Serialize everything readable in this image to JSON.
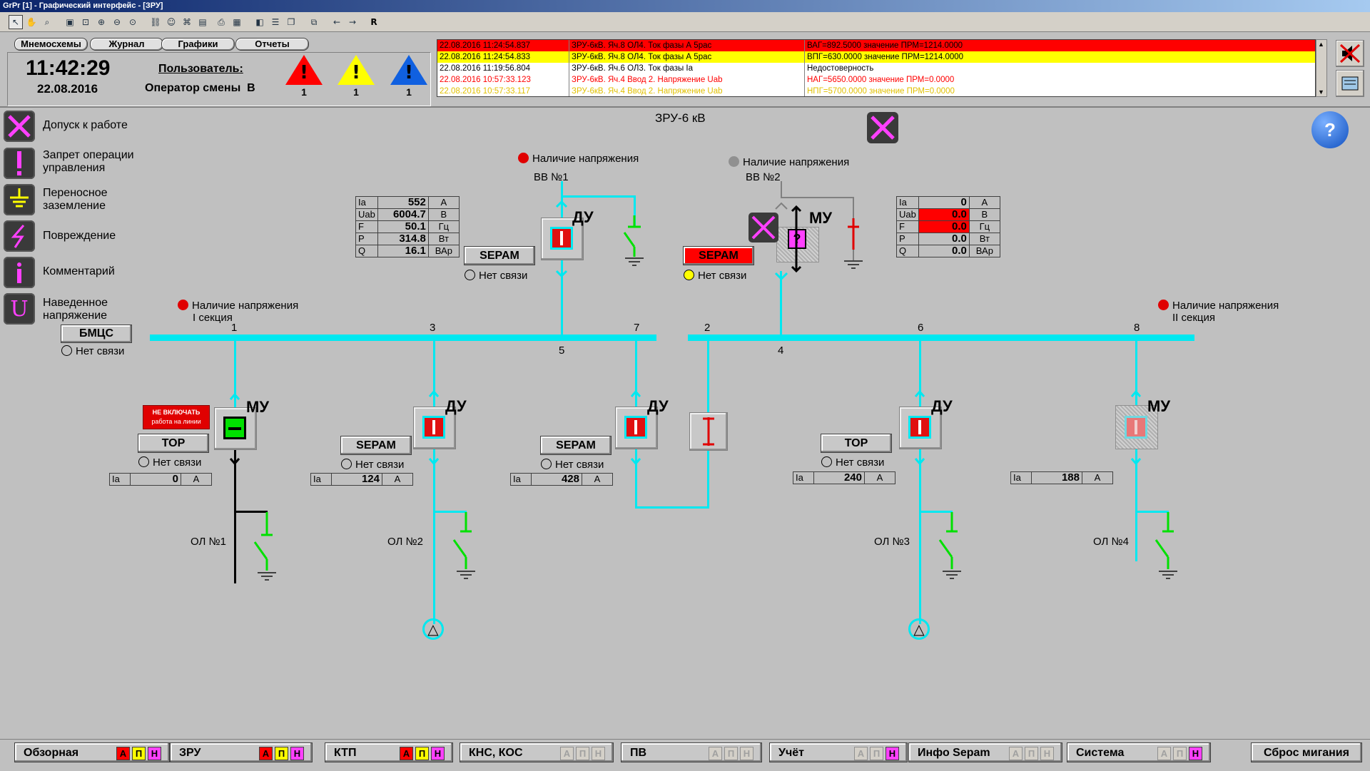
{
  "window": {
    "title": "GrPr [1] - Графический интерфейс - [ЗРУ]"
  },
  "toolbar": {
    "r_label": "R"
  },
  "header": {
    "tabs": [
      {
        "label": "Мнемосхемы"
      },
      {
        "label": "Журнал"
      },
      {
        "label": "Графики"
      },
      {
        "label": "Отчеты"
      }
    ],
    "clock": "11:42:29",
    "date": "22.08.2016",
    "user_label": "Пользователь:",
    "user_value": "Оператор смены  В",
    "alarm_counts": {
      "red": "1",
      "yellow": "1",
      "blue": "1"
    }
  },
  "events": [
    {
      "time": "22.08.2016 11:24:54.837",
      "source": "ЗРУ-6кВ. Яч.8 ОЛ4. Ток фазы А 5рас",
      "value": "ВАГ=892.5000  значение ПРМ=1214.0000",
      "bg": "#ff0000",
      "fg": "#000000"
    },
    {
      "time": "22.08.2016 11:24:54.833",
      "source": "ЗРУ-6кВ. Яч.8 ОЛ4. Ток фазы А 5рас",
      "value": "ВПГ=630.0000  значение ПРМ=1214.0000",
      "bg": "#ffff00",
      "fg": "#000000"
    },
    {
      "time": "22.08.2016 11:19:56.804",
      "source": "ЗРУ-6кВ. Яч.6 ОЛ3. Ток фазы Ia",
      "value": "Недостоверность",
      "bg": "#ffffff",
      "fg": "#000000"
    },
    {
      "time": "22.08.2016 10:57:33.123",
      "source": "ЗРУ-6кВ. Яч.4 Ввод 2. Напряжение Uab",
      "value": "НАГ=5650.0000  значение ПРМ=0.0000",
      "bg": "#ffffff",
      "fg": "#ff0000"
    },
    {
      "time": "22.08.2016 10:57:33.117",
      "source": "ЗРУ-6кВ. Яч.4 Ввод 2. Напряжение Uab",
      "value": "НПГ=5700.0000  значение ПРМ=0.0000",
      "bg": "#ffffff",
      "fg": "#e0c000"
    }
  ],
  "legend": [
    {
      "label": "Допуск к работе",
      "icon": "cross-tools-icon"
    },
    {
      "label": "Запрет операции управления",
      "icon": "exclamation-icon"
    },
    {
      "label": "Переносное заземление",
      "icon": "ground-icon"
    },
    {
      "label": "Повреждение",
      "icon": "lightning-icon"
    },
    {
      "label": "Комментарий",
      "icon": "info-icon"
    },
    {
      "label": "Наведенное напряжение",
      "icon": "induced-u-icon"
    }
  ],
  "legend_lines": [
    [
      "Допуск к работе"
    ],
    [
      "Запрет операции",
      "управления"
    ],
    [
      "Переносное",
      "заземление"
    ],
    [
      "Повреждение"
    ],
    [
      "Комментарий"
    ],
    [
      "Наведенное",
      "напряжение"
    ]
  ],
  "scheme": {
    "title": "ЗРУ-6 кВ",
    "voltage_label": "Наличие напряжения",
    "section1_label": "I секция",
    "section2_label": "II секция",
    "no_link": "Нет связи",
    "bmcs_label": "БМЦС",
    "input1_label": "ВВ №1",
    "input2_label": "ВВ №2",
    "cells": [
      "1",
      "3",
      "5",
      "7",
      "2",
      "4",
      "6",
      "8"
    ],
    "lines": [
      "ОЛ №1",
      "ОЛ №2",
      "ОЛ №3",
      "ОЛ №4"
    ],
    "modes": {
      "du": "ДУ",
      "mu": "МУ"
    },
    "sepam_label": "SEPAM",
    "tor_label": "TOP",
    "no_switch_label": "НЕ ВКЛЮЧАТЬ",
    "no_switch_sub": "работа на линии",
    "help_label": "?",
    "question_label": "?",
    "feeders": [
      {
        "k": "Ia",
        "v": "0",
        "u": "A"
      },
      {
        "k": "Ia",
        "v": "124",
        "u": "A"
      },
      {
        "k": "Ia",
        "v": "428",
        "u": "A"
      },
      {
        "k": "Ia",
        "v": "240",
        "u": "A"
      },
      {
        "k": "Ia",
        "v": "188",
        "u": "A"
      }
    ],
    "meas1": [
      {
        "k": "Ia",
        "v": "552",
        "u": "A"
      },
      {
        "k": "Uab",
        "v": "6004.7",
        "u": "B"
      },
      {
        "k": "F",
        "v": "50.1",
        "u": "Гц"
      },
      {
        "k": "P",
        "v": "314.8",
        "u": "Вт"
      },
      {
        "k": "Q",
        "v": "16.1",
        "u": "ВАр"
      }
    ],
    "meas2": [
      {
        "k": "Ia",
        "v": "0",
        "u": "A"
      },
      {
        "k": "Uab",
        "v": "0.0",
        "u": "B"
      },
      {
        "k": "F",
        "v": "0.0",
        "u": "Гц"
      },
      {
        "k": "P",
        "v": "0.0",
        "u": "Вт"
      },
      {
        "k": "Q",
        "v": "0.0",
        "u": "ВАр"
      }
    ]
  },
  "nav": [
    {
      "label": "Обзорная",
      "a": true,
      "p": true,
      "n": true
    },
    {
      "label": "ЗРУ",
      "a": true,
      "p": true,
      "n": true
    },
    {
      "label": "КТП",
      "a": true,
      "p": true,
      "n": true
    },
    {
      "label": "КНС, КОС",
      "a": false,
      "p": false,
      "n": false
    },
    {
      "label": "ПВ",
      "a": false,
      "p": false,
      "n": false
    },
    {
      "label": "Учёт",
      "a": false,
      "p": false,
      "n": true
    },
    {
      "label": "Инфо Sepam",
      "a": false,
      "p": false,
      "n": false
    },
    {
      "label": "Система",
      "a": false,
      "p": false,
      "n": true
    }
  ],
  "apn_letters": {
    "a": "А",
    "p": "П",
    "n": "Н"
  },
  "reset_label": "Сброс мигания",
  "colors": {
    "bus": "#00e8f0",
    "alarm_red": "#ff0000",
    "alarm_yellow": "#ffff00",
    "alarm_blue": "#1060e0",
    "magenta": "#ff40ff"
  }
}
